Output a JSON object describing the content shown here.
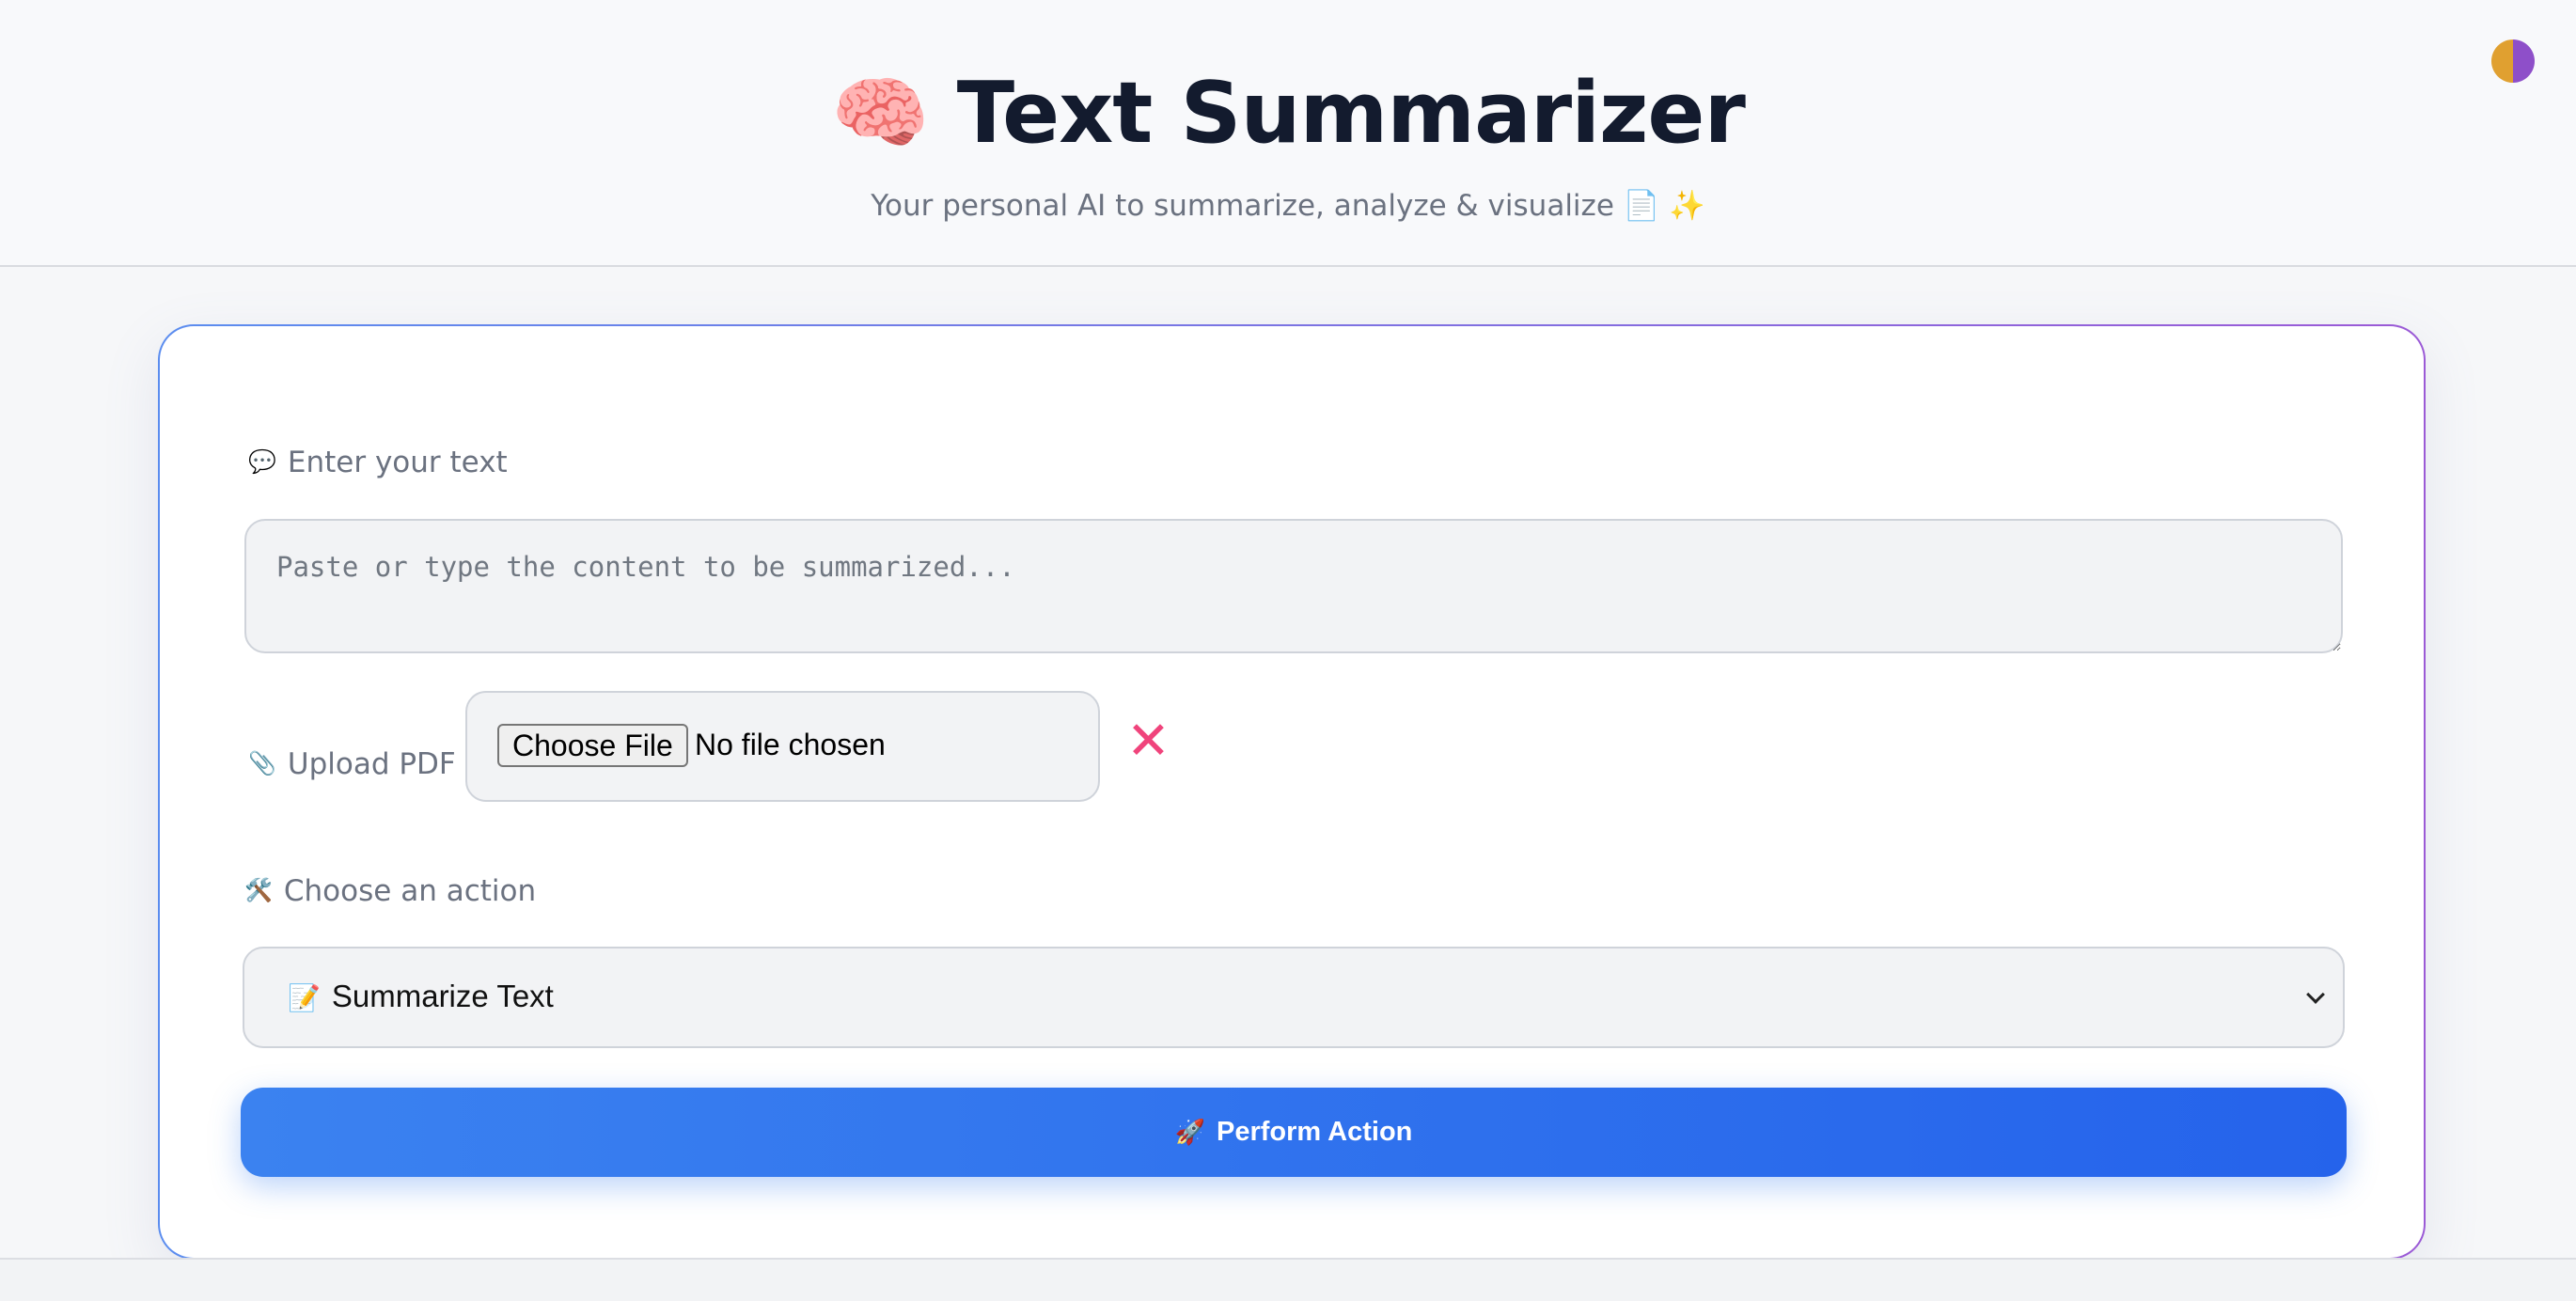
{
  "header": {
    "brain_emoji": "🧠",
    "title": "Text Summarizer",
    "subtitle": "Your personal AI to summarize, analyze & visualize 📄 ✨"
  },
  "theme_toggle": {
    "icon": "theme-toggle-icon"
  },
  "form": {
    "text_label_emoji": "💬",
    "text_label": "Enter your text",
    "text_placeholder": "Paste or type the content to be summarized...",
    "text_value": "",
    "pdf_label_emoji": "📎",
    "pdf_label": "Upload PDF",
    "file_button_label": "Choose File",
    "file_status": "No file chosen",
    "clear_symbol": "✕",
    "action_label_emoji": "🛠️",
    "action_label": "Choose an action",
    "selected_action_emoji": "📝",
    "selected_action": "Summarize Text",
    "submit_emoji": "🚀",
    "submit_label": "Perform Action"
  },
  "colors": {
    "accent_blue": "#3b82f0",
    "accent_purple": "#9b5ad6",
    "clear_pink": "#f0447c"
  }
}
